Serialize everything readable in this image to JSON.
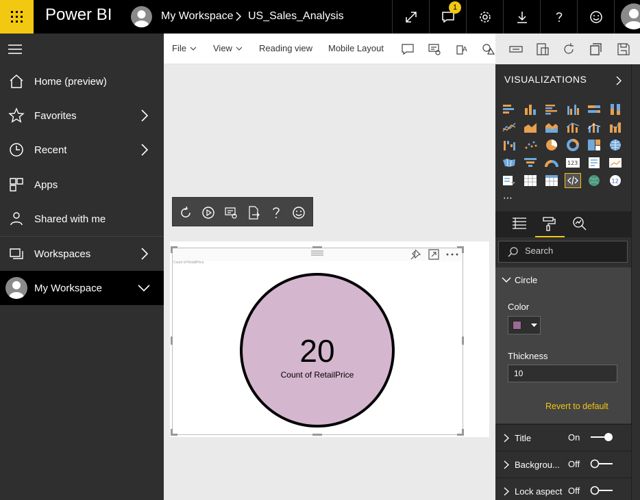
{
  "app": {
    "brand": "Power BI",
    "breadcrumb": {
      "workspace": "My Workspace",
      "report": "US_Sales_Analysis"
    },
    "notification_count": "1"
  },
  "sidebar": {
    "items": [
      {
        "label": "Home (preview)",
        "icon": "home-icon"
      },
      {
        "label": "Favorites",
        "icon": "star-icon"
      },
      {
        "label": "Recent",
        "icon": "clock-icon"
      },
      {
        "label": "Apps",
        "icon": "apps-icon"
      },
      {
        "label": "Shared with me",
        "icon": "shared-icon"
      },
      {
        "label": "Workspaces",
        "icon": "workspaces-icon"
      },
      {
        "label": "My Workspace",
        "icon": "avatar"
      }
    ]
  },
  "menubar": {
    "file": "File",
    "view": "View",
    "reading_view": "Reading view",
    "mobile_layout": "Mobile Layout"
  },
  "visual": {
    "header_title": "Count of RetailPrice",
    "value": "20",
    "label": "Count of RetailPrice",
    "circle_color": "#d5b6cf"
  },
  "pane": {
    "title": "VISUALIZATIONS",
    "search_placeholder": "Search",
    "circle_section": "Circle",
    "color_label": "Color",
    "color_value": "#9b6a95",
    "thickness_label": "Thickness",
    "thickness_value": "10",
    "revert": "Revert to default",
    "rows": [
      {
        "label": "Title",
        "state": "On"
      },
      {
        "label": "Backgrou...",
        "state": "Off"
      },
      {
        "label": "Lock aspect",
        "state": "Off"
      }
    ]
  },
  "colors": {
    "accent": "#f2c811",
    "topbar": "#000000",
    "sidebar": "#2f2f2f"
  }
}
